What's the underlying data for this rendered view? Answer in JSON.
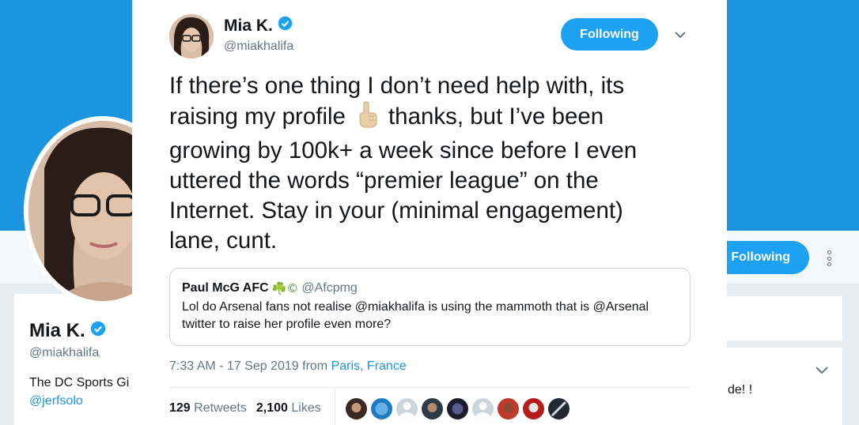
{
  "background": {
    "name": "Mia K.",
    "handle": "@miakhalifa",
    "bio": "The DC Sports Gi",
    "link": "@jerfsolo",
    "follow_label": "Following",
    "trailing_text": "de! !"
  },
  "tweet": {
    "author_name": "Mia K.",
    "author_handle": "@miakhalifa",
    "follow_label": "Following",
    "lines": [
      "If there’s one thing I don’t need help with, its",
      "thanks, but I’ve been",
      "growing by 100k+ a week since before I even",
      "uttered the words “premier league” on the",
      "Internet. Stay in your (minimal engagement)",
      "lane, cunt."
    ],
    "line2_prefix": "raising my profile",
    "quote": {
      "name": "Paul McG AFC",
      "name_suffix": "☘️©",
      "handle": "@Afcpmg",
      "text": "Lol do Arsenal fans not realise @miakhalifa is using the mammoth that is @Arsenal twitter to raise her profile even more?"
    },
    "time": "7:33 AM - 17 Sep 2019 from",
    "location": "Paris, France",
    "retweets_count": "129",
    "retweets_label": "Retweets",
    "likes_count": "2,100",
    "likes_label": "Likes"
  },
  "colors": {
    "accent": "#1da1f2",
    "banner": "#1b95e0",
    "text": "#14171a",
    "muted": "#657786"
  }
}
